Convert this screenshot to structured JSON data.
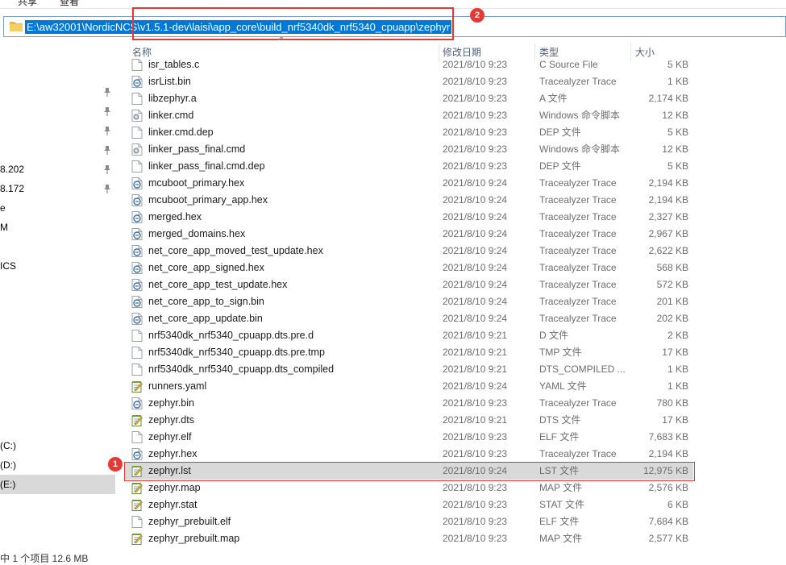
{
  "ribbon": {
    "tabs": [
      "共享",
      "查看"
    ]
  },
  "address": {
    "path": "E:\\aw32001\\NordicNCS\\v1.5.1-dev\\laisi\\app_core\\build_nrf5340dk_nrf5340_cpuapp\\zephyr"
  },
  "callouts": [
    "1",
    "2"
  ],
  "nav": {
    "items": [
      {
        "label": "",
        "pinned": true
      },
      {
        "label": "",
        "pinned": true
      },
      {
        "label": "",
        "pinned": true
      },
      {
        "label": "",
        "pinned": true
      },
      {
        "label": "8.202",
        "pinned": true
      },
      {
        "label": "8.172",
        "pinned": true
      },
      {
        "label": "e",
        "pinned": false
      },
      {
        "label": "M",
        "pinned": false
      },
      {
        "label": "",
        "pinned": false
      },
      {
        "label": "ICS",
        "pinned": false
      },
      {
        "label": "(C:)",
        "pinned": false
      },
      {
        "label": "(D:)",
        "pinned": false
      },
      {
        "label": "(E:)",
        "pinned": false,
        "selected": true
      }
    ]
  },
  "columns": {
    "name": "名称",
    "date": "修改日期",
    "type": "类型",
    "size": "大小"
  },
  "files": [
    {
      "name": "isr_tables.c",
      "date": "2021/8/10 9:23",
      "type": "C Source File",
      "size": "5 KB",
      "icon": "document-icon"
    },
    {
      "name": "isrList.bin",
      "date": "2021/8/10 9:23",
      "type": "Tracealyzer Trace",
      "size": "1 KB",
      "icon": "trace-icon"
    },
    {
      "name": "libzephyr.a",
      "date": "2021/8/10 9:23",
      "type": "A 文件",
      "size": "2,174 KB",
      "icon": "document-icon"
    },
    {
      "name": "linker.cmd",
      "date": "2021/8/10 9:23",
      "type": "Windows 命令脚本",
      "size": "12 KB",
      "icon": "gear-document-icon"
    },
    {
      "name": "linker.cmd.dep",
      "date": "2021/8/10 9:23",
      "type": "DEP 文件",
      "size": "5 KB",
      "icon": "document-icon"
    },
    {
      "name": "linker_pass_final.cmd",
      "date": "2021/8/10 9:23",
      "type": "Windows 命令脚本",
      "size": "12 KB",
      "icon": "gear-document-icon"
    },
    {
      "name": "linker_pass_final.cmd.dep",
      "date": "2021/8/10 9:23",
      "type": "DEP 文件",
      "size": "5 KB",
      "icon": "document-icon"
    },
    {
      "name": "mcuboot_primary.hex",
      "date": "2021/8/10 9:24",
      "type": "Tracealyzer Trace",
      "size": "2,194 KB",
      "icon": "trace-icon"
    },
    {
      "name": "mcuboot_primary_app.hex",
      "date": "2021/8/10 9:24",
      "type": "Tracealyzer Trace",
      "size": "2,194 KB",
      "icon": "trace-icon"
    },
    {
      "name": "merged.hex",
      "date": "2021/8/10 9:24",
      "type": "Tracealyzer Trace",
      "size": "2,327 KB",
      "icon": "trace-icon"
    },
    {
      "name": "merged_domains.hex",
      "date": "2021/8/10 9:24",
      "type": "Tracealyzer Trace",
      "size": "2,967 KB",
      "icon": "trace-icon"
    },
    {
      "name": "net_core_app_moved_test_update.hex",
      "date": "2021/8/10 9:24",
      "type": "Tracealyzer Trace",
      "size": "2,622 KB",
      "icon": "trace-icon"
    },
    {
      "name": "net_core_app_signed.hex",
      "date": "2021/8/10 9:24",
      "type": "Tracealyzer Trace",
      "size": "568 KB",
      "icon": "trace-icon"
    },
    {
      "name": "net_core_app_test_update.hex",
      "date": "2021/8/10 9:24",
      "type": "Tracealyzer Trace",
      "size": "572 KB",
      "icon": "trace-icon"
    },
    {
      "name": "net_core_app_to_sign.bin",
      "date": "2021/8/10 9:24",
      "type": "Tracealyzer Trace",
      "size": "201 KB",
      "icon": "trace-icon"
    },
    {
      "name": "net_core_app_update.bin",
      "date": "2021/8/10 9:24",
      "type": "Tracealyzer Trace",
      "size": "202 KB",
      "icon": "trace-icon"
    },
    {
      "name": "nrf5340dk_nrf5340_cpuapp.dts.pre.d",
      "date": "2021/8/10 9:21",
      "type": "D 文件",
      "size": "2 KB",
      "icon": "document-icon"
    },
    {
      "name": "nrf5340dk_nrf5340_cpuapp.dts.pre.tmp",
      "date": "2021/8/10 9:21",
      "type": "TMP 文件",
      "size": "17 KB",
      "icon": "document-icon"
    },
    {
      "name": "nrf5340dk_nrf5340_cpuapp.dts_compiled",
      "date": "2021/8/10 9:21",
      "type": "DTS_COMPILED ...",
      "size": "1 KB",
      "icon": "document-icon"
    },
    {
      "name": "runners.yaml",
      "date": "2021/8/10 9:24",
      "type": "YAML 文件",
      "size": "1 KB",
      "icon": "notepad-icon"
    },
    {
      "name": "zephyr.bin",
      "date": "2021/8/10 9:23",
      "type": "Tracealyzer Trace",
      "size": "780 KB",
      "icon": "trace-icon"
    },
    {
      "name": "zephyr.dts",
      "date": "2021/8/10 9:21",
      "type": "DTS 文件",
      "size": "17 KB",
      "icon": "notepad-icon"
    },
    {
      "name": "zephyr.elf",
      "date": "2021/8/10 9:23",
      "type": "ELF 文件",
      "size": "7,683 KB",
      "icon": "document-icon"
    },
    {
      "name": "zephyr.hex",
      "date": "2021/8/10 9:23",
      "type": "Tracealyzer Trace",
      "size": "2,194 KB",
      "icon": "trace-icon"
    },
    {
      "name": "zephyr.lst",
      "date": "2021/8/10 9:24",
      "type": "LST 文件",
      "size": "12,975 KB",
      "icon": "notepad-icon",
      "selected": true
    },
    {
      "name": "zephyr.map",
      "date": "2021/8/10 9:23",
      "type": "MAP 文件",
      "size": "2,576 KB",
      "icon": "notepad-icon"
    },
    {
      "name": "zephyr.stat",
      "date": "2021/8/10 9:23",
      "type": "STAT 文件",
      "size": "6 KB",
      "icon": "notepad-icon"
    },
    {
      "name": "zephyr_prebuilt.elf",
      "date": "2021/8/10 9:23",
      "type": "ELF 文件",
      "size": "7,684 KB",
      "icon": "document-icon"
    },
    {
      "name": "zephyr_prebuilt.map",
      "date": "2021/8/10 9:23",
      "type": "MAP 文件",
      "size": "2,577 KB",
      "icon": "notepad-icon"
    }
  ],
  "status": {
    "text": "中 1 个项目  12.6 MB"
  },
  "colors": {
    "selection": "#d9d9d9",
    "address_highlight": "#0078d7",
    "callout": "#e53935"
  }
}
